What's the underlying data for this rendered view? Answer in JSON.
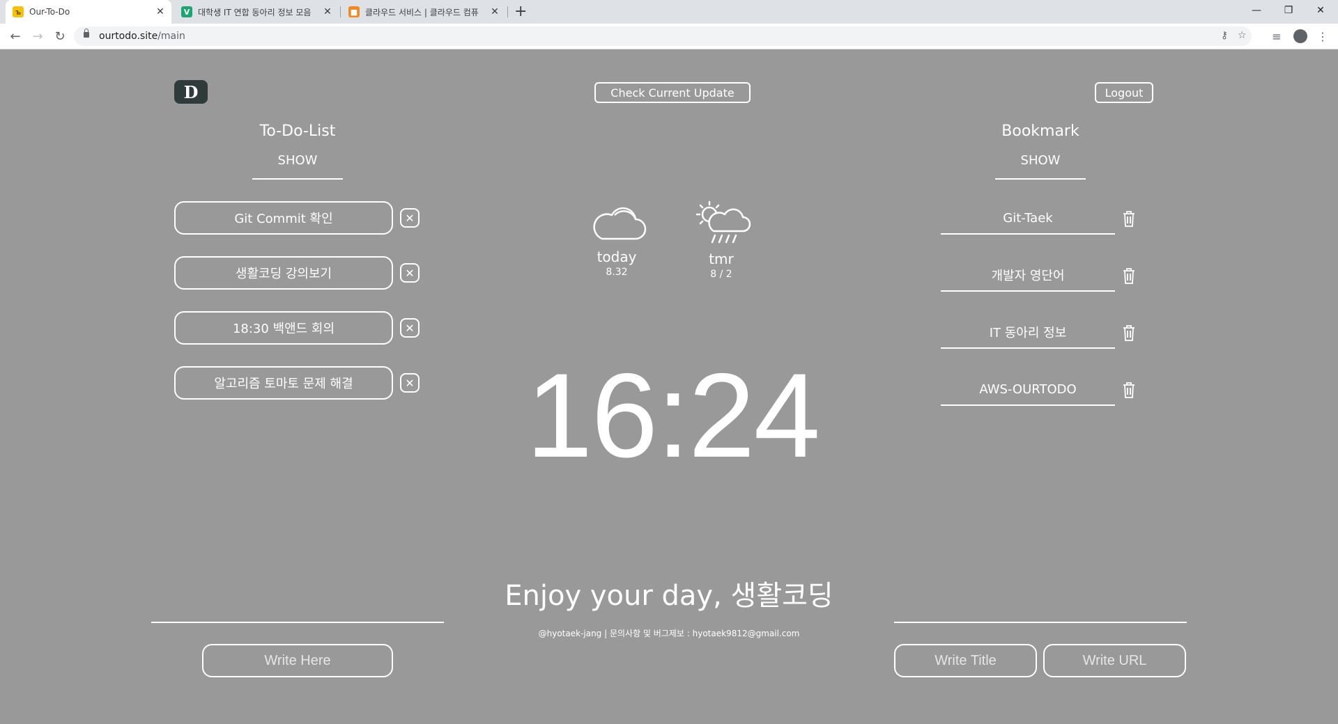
{
  "browser": {
    "tabs": [
      {
        "title": "Our-To-Do",
        "icon": "ourtodo-favicon"
      },
      {
        "title": "대학생 IT 연합 동아리 정보 모음",
        "icon": "v-favicon"
      },
      {
        "title": "클라우드 서비스 | 클라우드 컴퓨",
        "icon": "aws-favicon"
      }
    ],
    "url_host": "ourtodo.site",
    "url_path": "/main"
  },
  "header": {
    "logo_text": "D",
    "update_label": "Check Current Update",
    "logout_label": "Logout"
  },
  "todo": {
    "title": "To-Do-List",
    "show_label": "SHOW",
    "items": [
      {
        "text": "Git Commit 확인"
      },
      {
        "text": "생활코딩 강의보기"
      },
      {
        "text": "18:30 백앤드 회의"
      },
      {
        "text": "알고리즘 토마토 문제 해결"
      }
    ]
  },
  "weather": {
    "today": {
      "label": "today",
      "temp": "8.32",
      "icon": "cloud-icon"
    },
    "tomorrow": {
      "label": "tmr",
      "temp": "8 / 2",
      "icon": "sun-rain-icon"
    }
  },
  "clock": {
    "time": "16:24"
  },
  "bookmark": {
    "title": "Bookmark",
    "show_label": "SHOW",
    "items": [
      {
        "text": "Git-Taek"
      },
      {
        "text": "개발자 영단어"
      },
      {
        "text": "IT 동아리 정보"
      },
      {
        "text": "AWS-OURTODO"
      }
    ]
  },
  "greeting": "Enjoy your day, 생활코딩",
  "footer": "@hyotaek-jang | 문의사항 및 버그제보 : hyotaek9812@gmail.com",
  "inputs": {
    "todo_placeholder": "Write Here",
    "title_placeholder": "Write Title",
    "url_placeholder": "Write URL"
  },
  "colors": {
    "background": "#999999",
    "foreground": "#ffffff",
    "logo_bg": "#2f3a3a"
  }
}
